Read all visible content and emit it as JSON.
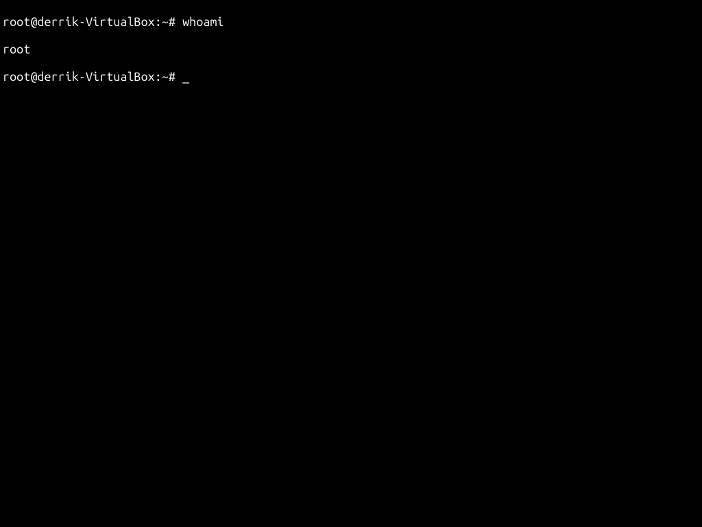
{
  "terminal": {
    "lines": [
      {
        "prompt": "root@derrik-VirtualBox:~# ",
        "command": "whoami"
      },
      {
        "output": "root"
      },
      {
        "prompt": "root@derrik-VirtualBox:~# ",
        "command": ""
      }
    ],
    "cursor": "_"
  }
}
